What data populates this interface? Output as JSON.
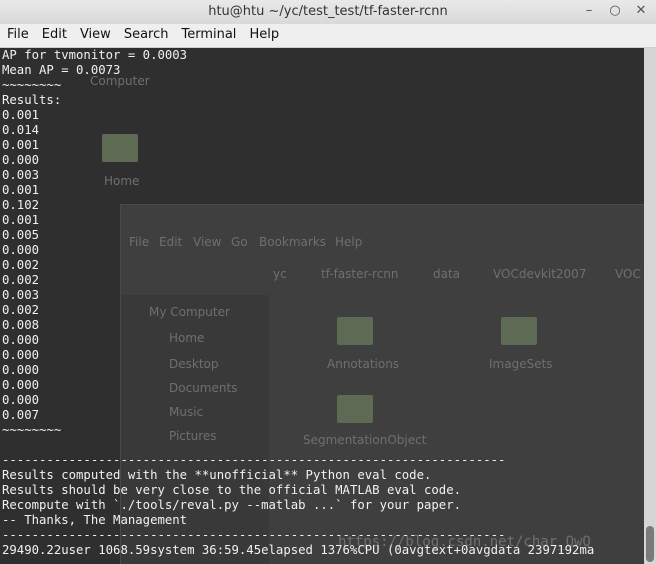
{
  "window": {
    "title": "htu@htu ~/yc/test_test/tf-faster-rcnn",
    "controls": {
      "minimize": "–",
      "maximize": "○",
      "close": "✕"
    }
  },
  "menu": [
    "File",
    "Edit",
    "View",
    "Search",
    "Terminal",
    "Help"
  ],
  "terminal_lines": [
    "AP for tvmonitor = 0.0003",
    "Mean AP = 0.0073",
    "~~~~~~~~",
    "Results:",
    "0.001",
    "0.014",
    "0.001",
    "0.000",
    "0.003",
    "0.001",
    "0.102",
    "0.001",
    "0.005",
    "0.000",
    "0.002",
    "0.002",
    "0.003",
    "0.002",
    "0.008",
    "0.000",
    "0.000",
    "0.000",
    "0.000",
    "0.000",
    "0.007",
    "~~~~~~~~",
    "",
    "--------------------------------------------------------------------",
    "Results computed with the **unofficial** Python eval code.",
    "Results should be very close to the official MATLAB eval code.",
    "Recompute with `./tools/reval.py --matlab ...` for your paper.",
    "-- Thanks, The Management",
    "--------------------------------------------------------------------",
    "29490.22user 1068.59system 36:59.45elapsed 1376%CPU (0avgtext+0avgdata 2397192ma"
  ],
  "background_window": {
    "menu": [
      "File",
      "Edit",
      "View",
      "Go",
      "Bookmarks",
      "Help"
    ],
    "path": [
      "yc",
      "tf-faster-rcnn",
      "data",
      "VOCdevkit2007",
      "VOC"
    ],
    "sidebar": [
      "My Computer",
      "Home",
      "Desktop",
      "Documents",
      "Music",
      "Pictures"
    ],
    "folders": [
      "Annotations",
      "ImageSets",
      "SegmentationObject"
    ],
    "desktop_labels": [
      "Computer",
      "Home"
    ]
  },
  "watermark": "https://blog.csdn.net/char_QwQ",
  "scrollbar": {
    "position_fraction": 1.0
  }
}
